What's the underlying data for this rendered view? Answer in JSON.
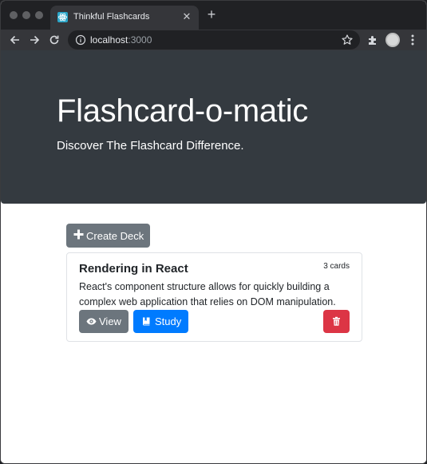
{
  "browser": {
    "tab_title": "Thinkful Flashcards",
    "url_host": "localhost",
    "url_port": ":3000",
    "icons": [
      "back-icon",
      "forward-icon",
      "reload-icon",
      "info-icon",
      "star-icon",
      "extensions-icon",
      "profile-avatar",
      "menu-icon"
    ]
  },
  "hero": {
    "title": "Flashcard-o-matic",
    "subtitle": "Discover The Flashcard Difference."
  },
  "actions": {
    "create_deck_label": "Create Deck"
  },
  "decks": [
    {
      "name": "Rendering in React",
      "card_count": "3 cards",
      "description": "React's component structure allows for quickly building a complex web application that relies on DOM manipulation.",
      "view_label": "View",
      "study_label": "Study"
    }
  ],
  "colors": {
    "hero_bg": "#343a40",
    "secondary": "#6c757d",
    "primary": "#007bff",
    "danger": "#dc3545"
  }
}
